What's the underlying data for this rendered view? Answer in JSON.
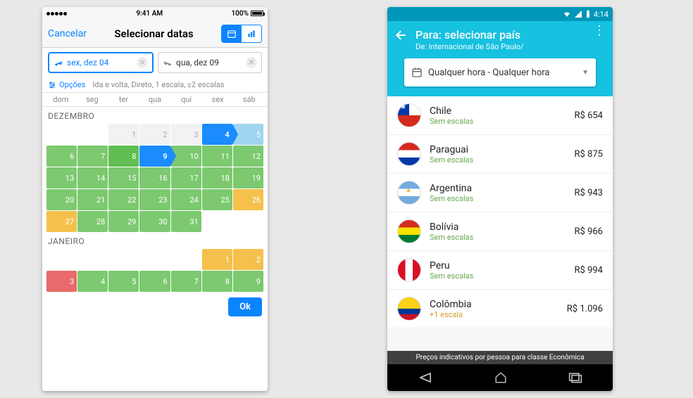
{
  "ios": {
    "status": {
      "time": "9:41 AM",
      "battery": "100%"
    },
    "header": {
      "cancel": "Cancelar",
      "title": "Selecionar datas"
    },
    "departField": "sex, dez 04",
    "returnField": "qua, dez 09",
    "optionsLabel": "Opções",
    "optionsDesc": "Ida e volta, Direto, 1 escala, ≥2 escalas",
    "weekdays": [
      "dom",
      "seg",
      "ter",
      "qua",
      "qui",
      "sex",
      "sáb"
    ],
    "months": {
      "dec": {
        "label": "Dezembro",
        "days": [
          {
            "n": "",
            "c": "empty"
          },
          {
            "n": "",
            "c": "empty"
          },
          {
            "n": "1",
            "c": "gray"
          },
          {
            "n": "2",
            "c": "gray"
          },
          {
            "n": "3",
            "c": "gray"
          },
          {
            "n": "4",
            "c": "sel"
          },
          {
            "n": "5",
            "c": "blue-lt"
          },
          {
            "n": "6",
            "c": "green"
          },
          {
            "n": "7",
            "c": "green"
          },
          {
            "n": "8",
            "c": "green2"
          },
          {
            "n": "9",
            "c": "sel"
          },
          {
            "n": "10",
            "c": "green"
          },
          {
            "n": "11",
            "c": "green"
          },
          {
            "n": "12",
            "c": "green"
          },
          {
            "n": "13",
            "c": "green"
          },
          {
            "n": "14",
            "c": "green"
          },
          {
            "n": "15",
            "c": "green"
          },
          {
            "n": "16",
            "c": "green"
          },
          {
            "n": "17",
            "c": "green"
          },
          {
            "n": "18",
            "c": "green"
          },
          {
            "n": "19",
            "c": "green"
          },
          {
            "n": "20",
            "c": "green"
          },
          {
            "n": "21",
            "c": "green"
          },
          {
            "n": "22",
            "c": "green"
          },
          {
            "n": "23",
            "c": "green"
          },
          {
            "n": "24",
            "c": "green"
          },
          {
            "n": "25",
            "c": "green"
          },
          {
            "n": "26",
            "c": "orange"
          },
          {
            "n": "27",
            "c": "orange"
          },
          {
            "n": "28",
            "c": "green"
          },
          {
            "n": "29",
            "c": "green"
          },
          {
            "n": "30",
            "c": "green"
          },
          {
            "n": "31",
            "c": "green"
          },
          {
            "n": "",
            "c": "empty"
          },
          {
            "n": "",
            "c": "empty"
          }
        ]
      },
      "jan": {
        "label": "Janeiro",
        "days": [
          {
            "n": "",
            "c": "empty"
          },
          {
            "n": "",
            "c": "empty"
          },
          {
            "n": "",
            "c": "empty"
          },
          {
            "n": "",
            "c": "empty"
          },
          {
            "n": "",
            "c": "empty"
          },
          {
            "n": "1",
            "c": "orange"
          },
          {
            "n": "2",
            "c": "orange"
          },
          {
            "n": "3",
            "c": "red"
          },
          {
            "n": "4",
            "c": "green"
          },
          {
            "n": "5",
            "c": "green"
          },
          {
            "n": "6",
            "c": "green"
          },
          {
            "n": "7",
            "c": "green"
          },
          {
            "n": "8",
            "c": "green"
          },
          {
            "n": "9",
            "c": "green"
          }
        ]
      }
    },
    "okLabel": "Ok"
  },
  "android": {
    "status": {
      "time": "4:14"
    },
    "header": {
      "title": "Para: selecionar país",
      "subtitle": "De: Internacional de São Paulo/"
    },
    "timeSelector": "Qualquer hora - Qualquer hora",
    "countries": [
      {
        "flag": "cl",
        "name": "Chile",
        "stops": "Sem escalas",
        "stopsClass": "",
        "price": "R$ 654"
      },
      {
        "flag": "py",
        "name": "Paraguai",
        "stops": "Sem escalas",
        "stopsClass": "",
        "price": "R$ 875"
      },
      {
        "flag": "ar",
        "name": "Argentina",
        "stops": "Sem escalas",
        "stopsClass": "",
        "price": "R$ 943"
      },
      {
        "flag": "bo",
        "name": "Bolívia",
        "stops": "Sem escalas",
        "stopsClass": "",
        "price": "R$ 966"
      },
      {
        "flag": "pe",
        "name": "Peru",
        "stops": "Sem escalas",
        "stopsClass": "",
        "price": "R$ 994"
      },
      {
        "flag": "co",
        "name": "Colômbia",
        "stops": "+1 escala",
        "stopsClass": "orange",
        "price": "R$ 1.096"
      }
    ],
    "footerNote": "Preços indicativos por pessoa para classe Econômica"
  }
}
